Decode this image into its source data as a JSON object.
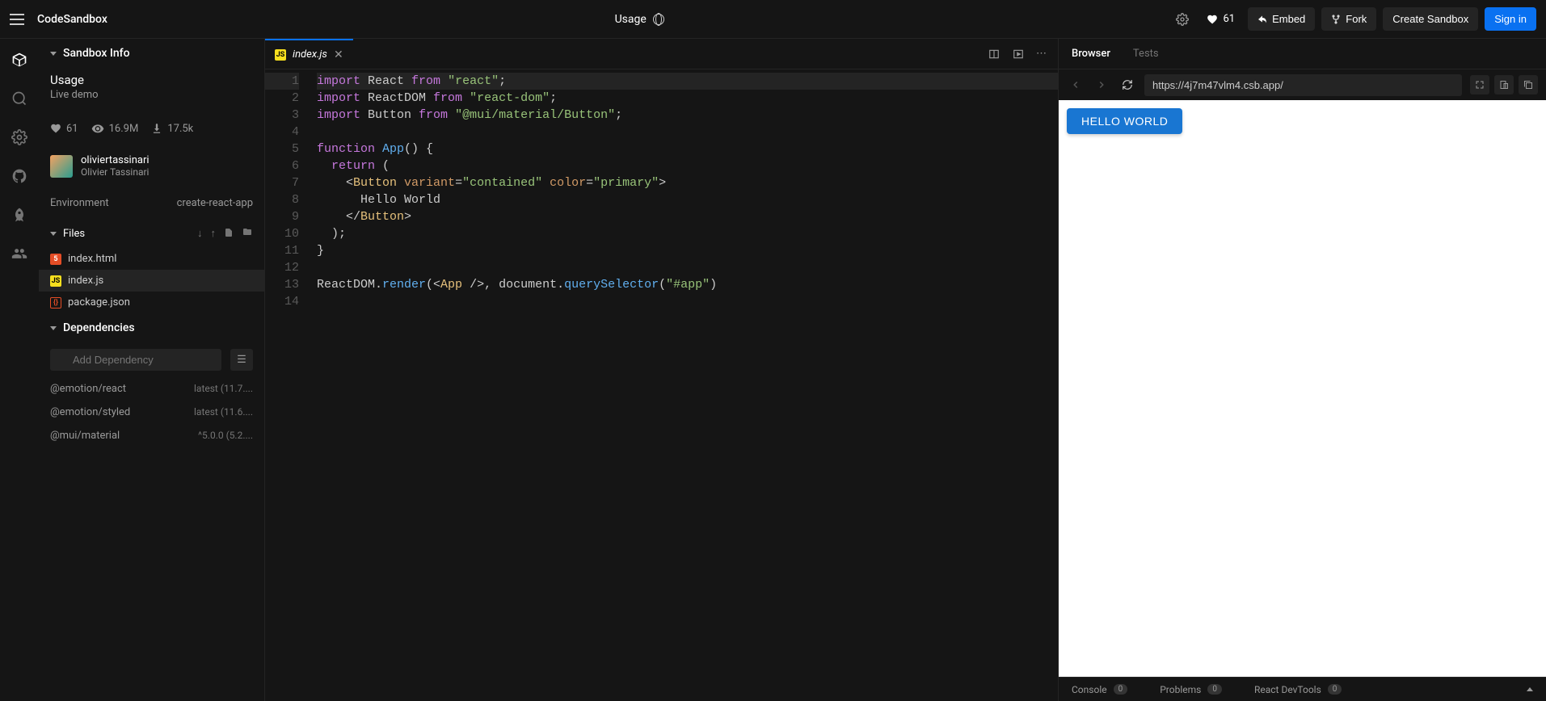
{
  "header": {
    "brand": "CodeSandbox",
    "title": "Usage",
    "likes": "61",
    "embed": "Embed",
    "fork": "Fork",
    "create": "Create Sandbox",
    "signin": "Sign in"
  },
  "sidebar": {
    "info_header": "Sandbox Info",
    "title": "Usage",
    "subtitle": "Live demo",
    "likes": "61",
    "views": "16.9M",
    "forks": "17.5k",
    "user": {
      "handle": "oliviertassinari",
      "name": "Olivier Tassinari"
    },
    "env_label": "Environment",
    "env_value": "create-react-app",
    "files_header": "Files",
    "files": [
      {
        "name": "index.html",
        "icon": "html"
      },
      {
        "name": "index.js",
        "icon": "js"
      },
      {
        "name": "package.json",
        "icon": "json"
      }
    ],
    "deps_header": "Dependencies",
    "dep_placeholder": "Add Dependency",
    "deps": [
      {
        "name": "@emotion/react",
        "ver": "latest (11.7...."
      },
      {
        "name": "@emotion/styled",
        "ver": "latest (11.6...."
      },
      {
        "name": "@mui/material",
        "ver": "^5.0.0 (5.2...."
      }
    ]
  },
  "editor": {
    "tab_name": "index.js",
    "lines": 14,
    "code": [
      [
        {
          "t": "kw",
          "v": "import"
        },
        {
          "t": "pn",
          "v": " React "
        },
        {
          "t": "kw",
          "v": "from"
        },
        {
          "t": "pn",
          "v": " "
        },
        {
          "t": "str",
          "v": "\"react\""
        },
        {
          "t": "pn",
          "v": ";"
        }
      ],
      [
        {
          "t": "kw",
          "v": "import"
        },
        {
          "t": "pn",
          "v": " ReactDOM "
        },
        {
          "t": "kw",
          "v": "from"
        },
        {
          "t": "pn",
          "v": " "
        },
        {
          "t": "str",
          "v": "\"react-dom\""
        },
        {
          "t": "pn",
          "v": ";"
        }
      ],
      [
        {
          "t": "kw",
          "v": "import"
        },
        {
          "t": "pn",
          "v": " Button "
        },
        {
          "t": "kw",
          "v": "from"
        },
        {
          "t": "pn",
          "v": " "
        },
        {
          "t": "str",
          "v": "\"@mui/material/Button\""
        },
        {
          "t": "pn",
          "v": ";"
        }
      ],
      [],
      [
        {
          "t": "kw",
          "v": "function"
        },
        {
          "t": "pn",
          "v": " "
        },
        {
          "t": "fn",
          "v": "App"
        },
        {
          "t": "pn",
          "v": "() {"
        }
      ],
      [
        {
          "t": "pn",
          "v": "  "
        },
        {
          "t": "kw",
          "v": "return"
        },
        {
          "t": "pn",
          "v": " ("
        }
      ],
      [
        {
          "t": "pn",
          "v": "    <"
        },
        {
          "t": "tag",
          "v": "Button"
        },
        {
          "t": "pn",
          "v": " "
        },
        {
          "t": "attr",
          "v": "variant"
        },
        {
          "t": "pn",
          "v": "="
        },
        {
          "t": "str",
          "v": "\"contained\""
        },
        {
          "t": "pn",
          "v": " "
        },
        {
          "t": "attr",
          "v": "color"
        },
        {
          "t": "pn",
          "v": "="
        },
        {
          "t": "str",
          "v": "\"primary\""
        },
        {
          "t": "pn",
          "v": ">"
        }
      ],
      [
        {
          "t": "pn",
          "v": "      Hello World"
        }
      ],
      [
        {
          "t": "pn",
          "v": "    </"
        },
        {
          "t": "tag",
          "v": "Button"
        },
        {
          "t": "pn",
          "v": ">"
        }
      ],
      [
        {
          "t": "pn",
          "v": "  );"
        }
      ],
      [
        {
          "t": "pn",
          "v": "}"
        }
      ],
      [],
      [
        {
          "t": "pn",
          "v": "ReactDOM."
        },
        {
          "t": "fn",
          "v": "render"
        },
        {
          "t": "pn",
          "v": "(<"
        },
        {
          "t": "tag",
          "v": "App"
        },
        {
          "t": "pn",
          "v": " />, document."
        },
        {
          "t": "fn",
          "v": "querySelector"
        },
        {
          "t": "pn",
          "v": "("
        },
        {
          "t": "str",
          "v": "\"#app\""
        },
        {
          "t": "pn",
          "v": ")"
        }
      ],
      []
    ]
  },
  "preview": {
    "tabs": {
      "browser": "Browser",
      "tests": "Tests"
    },
    "url": "https://4j7m47vlm4.csb.app/",
    "button_text": "HELLO WORLD",
    "console": {
      "console": "Console",
      "problems": "Problems",
      "devtools": "React DevTools",
      "zero": "0"
    }
  }
}
